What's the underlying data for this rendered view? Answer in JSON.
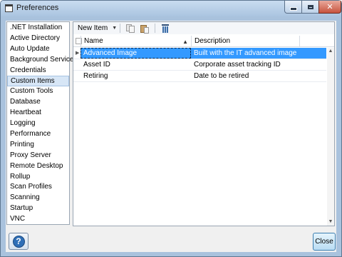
{
  "window": {
    "title": "Preferences"
  },
  "nav": {
    "items": [
      {
        "label": ".NET Installation",
        "selected": false
      },
      {
        "label": "Active Directory",
        "selected": false
      },
      {
        "label": "Auto Update",
        "selected": false
      },
      {
        "label": "Background Service",
        "selected": false
      },
      {
        "label": "Credentials",
        "selected": false
      },
      {
        "label": "Custom Items",
        "selected": true
      },
      {
        "label": "Custom Tools",
        "selected": false
      },
      {
        "label": "Database",
        "selected": false
      },
      {
        "label": "Heartbeat",
        "selected": false
      },
      {
        "label": "Logging",
        "selected": false
      },
      {
        "label": "Performance",
        "selected": false
      },
      {
        "label": "Printing",
        "selected": false
      },
      {
        "label": "Proxy Server",
        "selected": false
      },
      {
        "label": "Remote Desktop",
        "selected": false
      },
      {
        "label": "Rollup",
        "selected": false
      },
      {
        "label": "Scan Profiles",
        "selected": false
      },
      {
        "label": "Scanning",
        "selected": false
      },
      {
        "label": "Startup",
        "selected": false
      },
      {
        "label": "VNC",
        "selected": false
      }
    ]
  },
  "toolbar": {
    "new_item_label": "New Item"
  },
  "grid": {
    "columns": [
      "Name",
      "Description"
    ],
    "rows": [
      {
        "name": "Advanced Image",
        "description": "Built with the IT advanced image",
        "selected": true
      },
      {
        "name": "Asset ID",
        "description": "Corporate asset tracking ID",
        "selected": false
      },
      {
        "name": "Retiring",
        "description": "Date to be retired",
        "selected": false
      }
    ]
  },
  "footer": {
    "close_label": "Close"
  },
  "colors": {
    "selection": "#3399ff",
    "nav_selection": "#d7e6f6",
    "title_bar": "#aac4e0"
  }
}
